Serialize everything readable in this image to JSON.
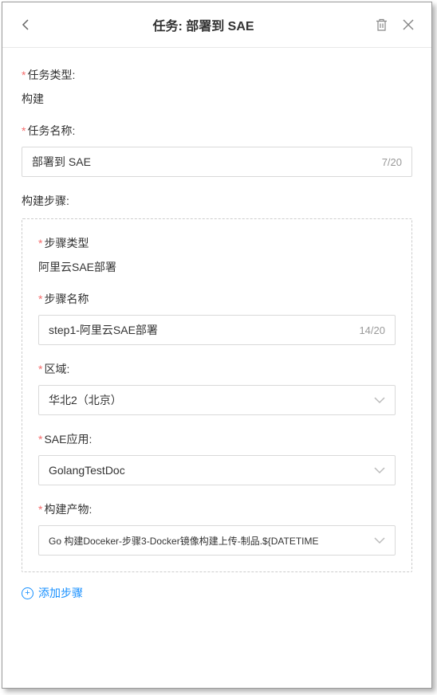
{
  "header": {
    "title": "任务: 部署到 SAE"
  },
  "task": {
    "type_label": "任务类型:",
    "type_value": "构建",
    "name_label": "任务名称:",
    "name_value": "部署到 SAE",
    "name_count": "7/20"
  },
  "steps": {
    "section_label": "构建步骤:",
    "step": {
      "type_label": "步骤类型",
      "type_value": "阿里云SAE部署",
      "name_label": "步骤名称",
      "name_value": "step1-阿里云SAE部署",
      "name_count": "14/20",
      "region_label": "区域:",
      "region_value": "华北2（北京）",
      "app_label": "SAE应用:",
      "app_value": "GolangTestDoc",
      "artifact_label": "构建产物:",
      "artifact_value": "Go 构建Doceker-步骤3-Docker镜像构建上传-制品.${DATETIME"
    },
    "add_step_label": "添加步骤"
  }
}
